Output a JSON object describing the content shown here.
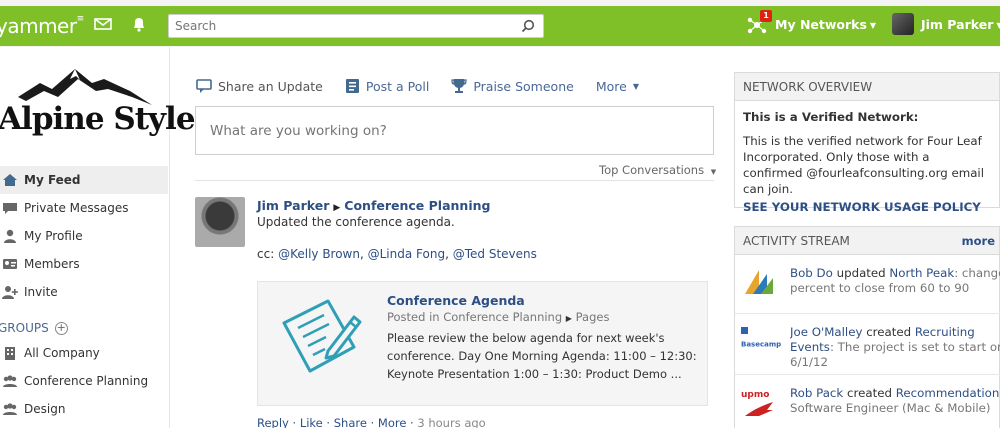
{
  "topbar": {
    "logo": "yammer",
    "search_placeholder": "Search",
    "networks_label": "My Networks",
    "networks_badge": "1",
    "user_name": "Jim Parker",
    "icons": [
      "mail-icon",
      "bell-icon",
      "search-icon",
      "networks-icon"
    ]
  },
  "sidebar": {
    "brand": "Alpine Style",
    "items": [
      {
        "label": "My Feed",
        "icon": "home-icon"
      },
      {
        "label": "Private Messages",
        "icon": "messages-icon"
      },
      {
        "label": "My Profile",
        "icon": "profile-icon"
      },
      {
        "label": "Members",
        "icon": "members-icon"
      },
      {
        "label": "Invite",
        "icon": "invite-icon"
      }
    ],
    "groups_label": "GROUPS",
    "groups": [
      {
        "label": "All Company",
        "icon": "building-icon"
      },
      {
        "label": "Conference Planning",
        "icon": "group-icon"
      },
      {
        "label": "Design",
        "icon": "group-icon"
      }
    ]
  },
  "publisher": {
    "tabs": [
      "Share an Update",
      "Post a Poll",
      "Praise Someone",
      "More"
    ],
    "placeholder": "What are you working on?",
    "sort_label": "Top Conversations"
  },
  "post": {
    "author": "Jim Parker",
    "group": "Conference Planning",
    "body": "Updated the conference agenda.",
    "cc_label": "cc:",
    "cc": [
      "@Kelly Brown",
      "@Linda Fong",
      "@Ted Stevens"
    ],
    "attachment": {
      "title": "Conference Agenda",
      "meta_prefix": "Posted in Conference Planning",
      "meta_suffix": "Pages",
      "desc": "Please review the below agenda for next week's conference. Day One Morning Agenda: 11:00 – 12:30: Keynote Presentation 1:00 – 1:30: Product Demo ..."
    },
    "actions": [
      "Reply",
      "Like",
      "Share",
      "More"
    ],
    "time": "3 hours ago"
  },
  "overview": {
    "heading": "NETWORK OVERVIEW",
    "title": "This is a Verified Network:",
    "text": "This is the verified network for Four Leaf Incorporated. Only those with a confirmed @fourleafconsulting.org email can join.",
    "policy": "SEE YOUR NETWORK USAGE POLICY"
  },
  "activity": {
    "heading": "ACTIVITY STREAM",
    "more": "more",
    "rows": [
      {
        "user": "Bob Do",
        "verb": "updated",
        "object": "North Peak",
        "rest": ": changed",
        "line2": "percent to close from 60 to 90",
        "logo": "dynamics-logo"
      },
      {
        "user": "Joe O'Malley",
        "verb": "created",
        "object": "Recruiting",
        "rest": "",
        "line2": "Events",
        "line2b": ": The project is set to start on",
        "line3": "6/1/12",
        "logo": "basecamp-logo",
        "logo_text": "Basecamp"
      },
      {
        "user": "Rob Pack",
        "verb": "created",
        "object": "Recommendation",
        "rest": ":",
        "line2": "Software Engineer (Mac & Mobile)",
        "logo": "upmo-logo",
        "logo_text": "upmo"
      }
    ]
  }
}
